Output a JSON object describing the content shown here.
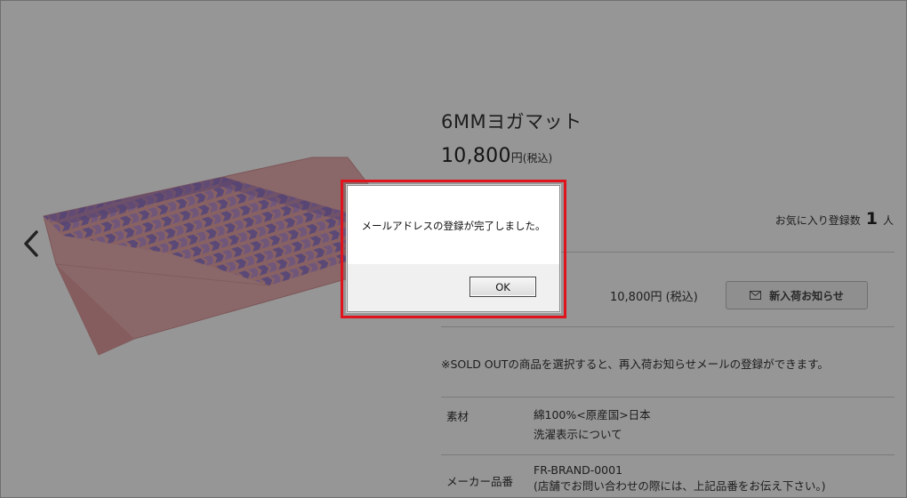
{
  "product": {
    "title": "6MMヨガマット",
    "price_number": "10,800",
    "price_unit": "円",
    "price_tax": "(税込)"
  },
  "favorites": {
    "label": "お気に入り登録数",
    "count": "1",
    "unit": "人"
  },
  "variant_row": {
    "price": "10,800円 (税込)",
    "notify_button": "新入荷お知らせ"
  },
  "notice": "※SOLD OUTの商品を選択すると、再入荷お知らせメールの登録ができます。",
  "specs": [
    {
      "label": "素材",
      "lines": [
        "綿100%<原産国>日本",
        "洗濯表示について"
      ]
    },
    {
      "label": "メーカー品番",
      "lines": [
        "FR-BRAND-0001",
        "(店舗でお問い合わせの際には、上記品番をお伝え下さい。)"
      ]
    }
  ],
  "icons": {
    "prev": "chevron-left-icon",
    "mail": "mail-icon"
  },
  "dialog": {
    "message": "メールアドレスの登録が完了しました。",
    "ok_label": "OK"
  },
  "colors": {
    "highlight_border": "#e0141c",
    "mat_pink": "#e8a5a8",
    "mat_pattern": "#9a7cc9"
  }
}
